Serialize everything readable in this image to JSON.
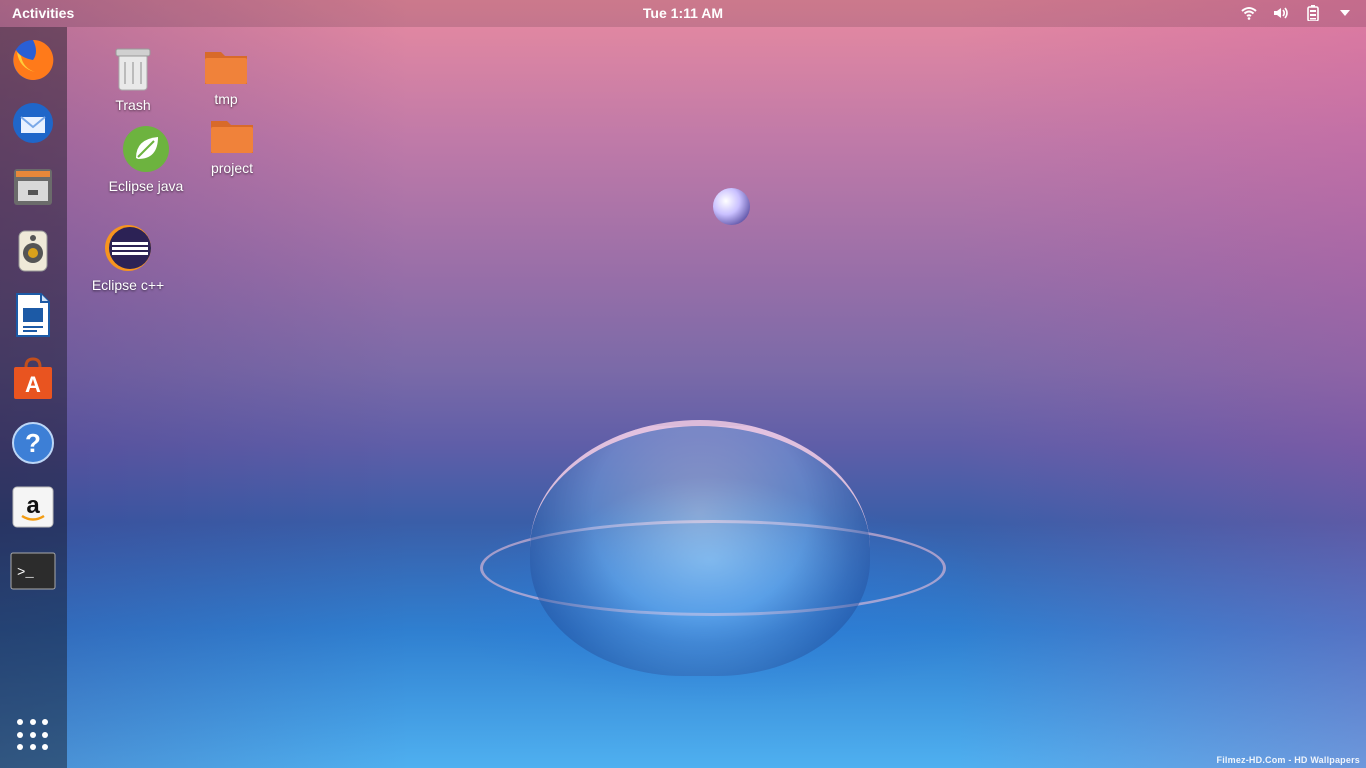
{
  "topbar": {
    "activities_label": "Activities",
    "clock": "Tue  1:11 AM",
    "tray": {
      "wifi_icon": "wifi-icon",
      "volume_icon": "speaker-icon",
      "battery_icon": "battery-icon",
      "menu_icon": "chevron-down-icon"
    }
  },
  "dock": {
    "items": [
      {
        "name": "firefox",
        "icon": "firefox-icon"
      },
      {
        "name": "thunderbird",
        "icon": "thunderbird-icon"
      },
      {
        "name": "files",
        "icon": "file-manager-icon"
      },
      {
        "name": "rhythmbox",
        "icon": "speaker-icon"
      },
      {
        "name": "libreoffice-writer",
        "icon": "document-icon"
      },
      {
        "name": "ubuntu-software",
        "icon": "software-bag-icon"
      },
      {
        "name": "help",
        "icon": "help-icon"
      },
      {
        "name": "amazon",
        "icon": "amazon-icon"
      },
      {
        "name": "terminal",
        "icon": "terminal-icon"
      }
    ],
    "show_apps_icon": "app-grid-icon"
  },
  "desktop": {
    "icons": [
      {
        "label": "Trash",
        "icon": "trash-icon"
      },
      {
        "label": "tmp",
        "icon": "folder-icon"
      },
      {
        "label": "Eclipse java",
        "icon": "spring-leaf-icon"
      },
      {
        "label": "project",
        "icon": "folder-icon"
      },
      {
        "label": "Eclipse c++",
        "icon": "eclipse-icon"
      }
    ]
  },
  "watermark": "Filmez-HD.Com - HD Wallpapers",
  "colors": {
    "folder": "#f0823a",
    "dock_bg": "#1e1e2a",
    "text": "#ffffff"
  }
}
